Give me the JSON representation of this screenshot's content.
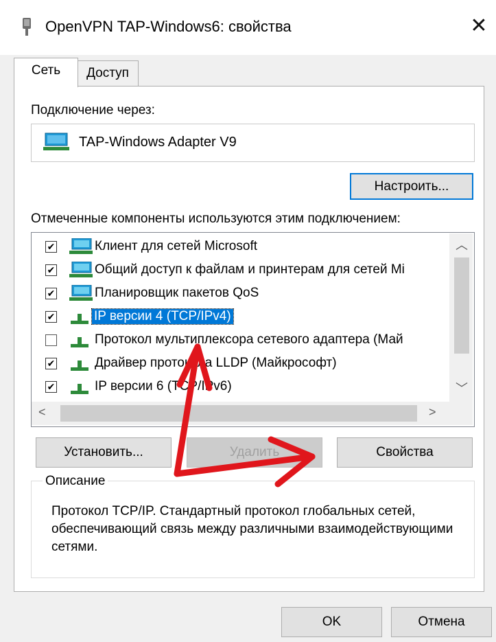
{
  "window": {
    "title": "OpenVPN TAP-Windows6: свойства",
    "close_glyph": "✕"
  },
  "tabs": [
    {
      "label": "Сеть",
      "active": true
    },
    {
      "label": "Доступ",
      "active": false
    }
  ],
  "connect_via": {
    "label": "Подключение через:",
    "adapter": "TAP-Windows Adapter V9",
    "configure_button": "Настроить..."
  },
  "components": {
    "label": "Отмеченные компоненты используются этим подключением:",
    "items": [
      {
        "text": "Клиент для сетей Microsoft",
        "checked": true,
        "icon": "network-client-icon",
        "selected": false
      },
      {
        "text": "Общий доступ к файлам и принтерам для сетей Mi",
        "checked": true,
        "icon": "network-service-icon",
        "selected": false
      },
      {
        "text": "Планировщик пакетов QoS",
        "checked": true,
        "icon": "network-service-icon",
        "selected": false
      },
      {
        "text": "IP версии 4 (TCP/IPv4)",
        "checked": true,
        "icon": "protocol-icon",
        "selected": true
      },
      {
        "text": "Протокол мультиплексора сетевого адаптера (Май",
        "checked": false,
        "icon": "protocol-icon",
        "selected": false
      },
      {
        "text": "Драйвер протокола LLDP (Майкрософт)",
        "checked": true,
        "icon": "protocol-icon",
        "selected": false
      },
      {
        "text": "IP версии 6 (TCP/IPv6)",
        "checked": true,
        "icon": "protocol-icon",
        "selected": false
      }
    ]
  },
  "actions": {
    "install": "Установить...",
    "remove": "Удалить",
    "properties": "Свойства"
  },
  "description": {
    "title": "Описание",
    "text": "Протокол TCP/IP. Стандартный протокол глобальных сетей, обеспечивающий связь между различными взаимодействующими сетями."
  },
  "footer": {
    "ok": "OK",
    "cancel": "Отмена"
  },
  "colors": {
    "accent": "#0078d7",
    "annotation": "#e0161c"
  }
}
